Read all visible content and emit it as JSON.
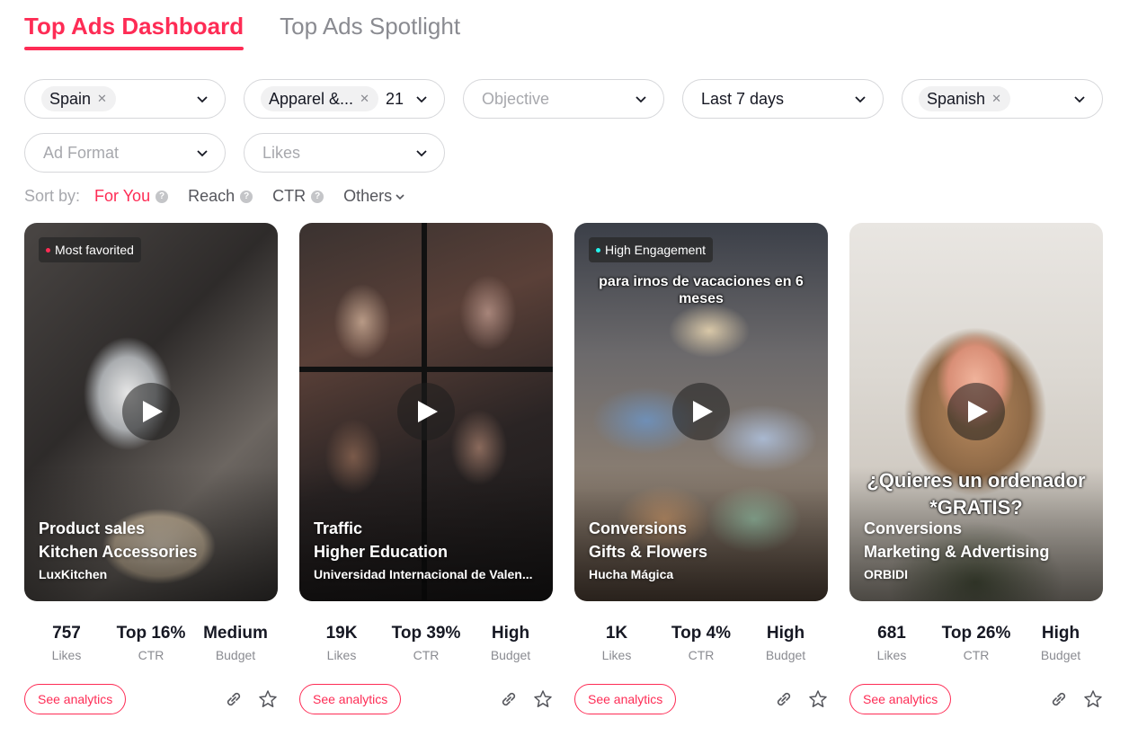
{
  "tabs": [
    {
      "label": "Top Ads Dashboard",
      "active": true
    },
    {
      "label": "Top Ads Spotlight",
      "active": false
    }
  ],
  "filters": {
    "country": {
      "chip": "Spain"
    },
    "industry": {
      "chip": "Apparel &...",
      "count": "21"
    },
    "objective": {
      "placeholder": "Objective"
    },
    "period": {
      "value": "Last 7 days"
    },
    "language": {
      "chip": "Spanish"
    },
    "ad_format": {
      "placeholder": "Ad Format"
    },
    "likes": {
      "placeholder": "Likes"
    }
  },
  "sort": {
    "label": "Sort by:",
    "options": [
      {
        "label": "For You",
        "active": true
      },
      {
        "label": "Reach"
      },
      {
        "label": "CTR"
      },
      {
        "label": "Others"
      }
    ]
  },
  "colors": {
    "accent": "#fe2c55",
    "engagement_dot": "#25f4ee"
  },
  "cards": [
    {
      "badge": "Most favorited",
      "objective": "Product sales",
      "industry": "Kitchen Accessories",
      "brand": "LuxKitchen",
      "likes": "757",
      "likes_label": "Likes",
      "ctr": "Top 16%",
      "ctr_label": "CTR",
      "budget": "Medium",
      "budget_label": "Budget",
      "analytics": "See analytics"
    },
    {
      "objective": "Traffic",
      "industry": "Higher Education",
      "brand": "Universidad Internacional de Valen...",
      "likes": "19K",
      "likes_label": "Likes",
      "ctr": "Top 39%",
      "ctr_label": "CTR",
      "budget": "High",
      "budget_label": "Budget",
      "analytics": "See analytics"
    },
    {
      "badge": "High Engagement",
      "overlay": "para irnos de vacaciones en 6 meses",
      "objective": "Conversions",
      "industry": "Gifts & Flowers",
      "brand": "Hucha Mágica",
      "likes": "1K",
      "likes_label": "Likes",
      "ctr": "Top 4%",
      "ctr_label": "CTR",
      "budget": "High",
      "budget_label": "Budget",
      "analytics": "See analytics"
    },
    {
      "overlay": "¿Quieres un ordenador *GRATIS?",
      "objective": "Conversions",
      "industry": "Marketing & Advertising",
      "brand": "ORBIDI",
      "likes": "681",
      "likes_label": "Likes",
      "ctr": "Top 26%",
      "ctr_label": "CTR",
      "budget": "High",
      "budget_label": "Budget",
      "analytics": "See analytics"
    }
  ]
}
